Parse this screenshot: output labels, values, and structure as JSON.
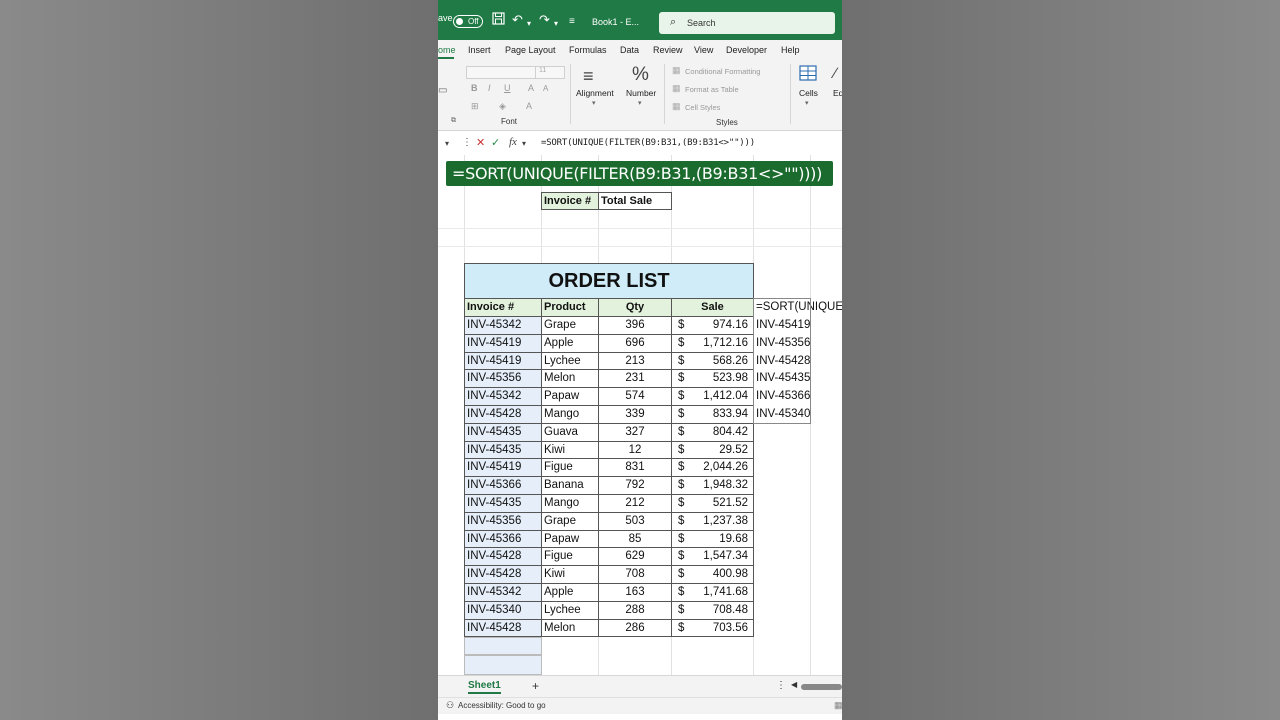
{
  "titlebar": {
    "autosave_label": "ave",
    "toggle_label": "Off",
    "doc_title": "Book1  -  E...",
    "search_placeholder": "Search"
  },
  "tabs": [
    "ome",
    "Insert",
    "Page Layout",
    "Formulas",
    "Data",
    "Review",
    "View",
    "Developer",
    "Help"
  ],
  "ribbon": {
    "font_size": "11",
    "font_group": "Font",
    "alignment": "Alignment",
    "number": "Number",
    "styles_group": "Styles",
    "conditional_formatting": "Conditional Formatting",
    "format_as_table": "Format as Table",
    "cell_styles": "Cell Styles",
    "cells": "Cells",
    "editing": "Edi"
  },
  "formula_bar": {
    "fx": "fx",
    "formula": "=SORT(UNIQUE(FILTER(B9:B31,(B9:B31<>\"\")))"
  },
  "overlay_formula": "=SORT(UNIQUE(FILTER(B9:B31,(B9:B31<>\"\"))))",
  "summary_headers": {
    "invoice": "Invoice #",
    "total": "Total Sale"
  },
  "order_list": {
    "title": "ORDER LIST",
    "headers": {
      "invoice": "Invoice #",
      "product": "Product",
      "qty": "Qty",
      "sale": "Sale"
    },
    "rows": [
      {
        "invoice": "INV-45342",
        "product": "Grape",
        "qty": "396",
        "currency": "$",
        "sale": "974.16"
      },
      {
        "invoice": "INV-45419",
        "product": "Apple",
        "qty": "696",
        "currency": "$",
        "sale": "1,712.16"
      },
      {
        "invoice": "INV-45419",
        "product": "Lychee",
        "qty": "213",
        "currency": "$",
        "sale": "568.26"
      },
      {
        "invoice": "INV-45356",
        "product": "Melon",
        "qty": "231",
        "currency": "$",
        "sale": "523.98"
      },
      {
        "invoice": "INV-45342",
        "product": "Papaw",
        "qty": "574",
        "currency": "$",
        "sale": "1,412.04"
      },
      {
        "invoice": "INV-45428",
        "product": "Mango",
        "qty": "339",
        "currency": "$",
        "sale": "833.94"
      },
      {
        "invoice": "INV-45435",
        "product": "Guava",
        "qty": "327",
        "currency": "$",
        "sale": "804.42"
      },
      {
        "invoice": "INV-45435",
        "product": "Kiwi",
        "qty": "12",
        "currency": "$",
        "sale": "29.52"
      },
      {
        "invoice": "INV-45419",
        "product": "Figue",
        "qty": "831",
        "currency": "$",
        "sale": "2,044.26"
      },
      {
        "invoice": "INV-45366",
        "product": "Banana",
        "qty": "792",
        "currency": "$",
        "sale": "1,948.32"
      },
      {
        "invoice": "INV-45435",
        "product": "Mango",
        "qty": "212",
        "currency": "$",
        "sale": "521.52"
      },
      {
        "invoice": "INV-45356",
        "product": "Grape",
        "qty": "503",
        "currency": "$",
        "sale": "1,237.38"
      },
      {
        "invoice": "INV-45366",
        "product": "Papaw",
        "qty": "85",
        "currency": "$",
        "sale": "19.68"
      },
      {
        "invoice": "INV-45428",
        "product": "Figue",
        "qty": "629",
        "currency": "$",
        "sale": "1,547.34"
      },
      {
        "invoice": "INV-45428",
        "product": "Kiwi",
        "qty": "708",
        "currency": "$",
        "sale": "400.98"
      },
      {
        "invoice": "INV-45342",
        "product": "Apple",
        "qty": "163",
        "currency": "$",
        "sale": "1,741.68"
      },
      {
        "invoice": "INV-45340",
        "product": "Lychee",
        "qty": "288",
        "currency": "$",
        "sale": "708.48"
      },
      {
        "invoice": "INV-45428",
        "product": "Melon",
        "qty": "286",
        "currency": "$",
        "sale": "703.56"
      }
    ]
  },
  "spill": {
    "formula_preview": "=SORT(UNIQUE(",
    "values": [
      "INV-45419",
      "INV-45356",
      "INV-45428",
      "INV-45435",
      "INV-45366",
      "INV-45340"
    ]
  },
  "sheet_tab": "Sheet1",
  "add_sheet": "+",
  "status": "Accessibility: Good to go",
  "colors": {
    "excel_green": "#1f7a45",
    "overlay_green": "#1b6b2e",
    "header_green": "#e2f2dc",
    "title_blue": "#d0ecf8"
  }
}
